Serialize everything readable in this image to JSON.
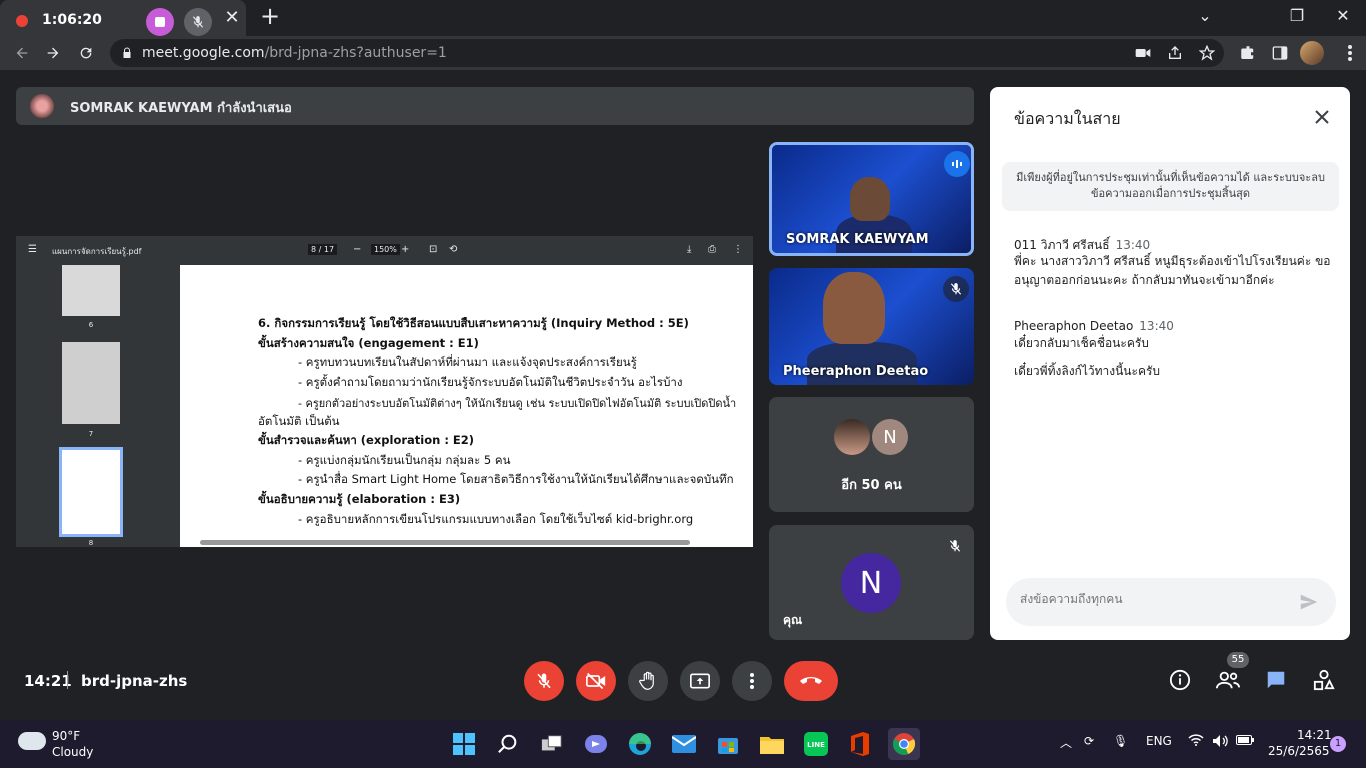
{
  "recording": {
    "time": "1:06:20"
  },
  "browser": {
    "url_domain": "meet.google.com",
    "url_path": "/brd-jpna-zhs?authuser=1"
  },
  "presenter": {
    "text": "SOMRAK KAEWYAM กำลังนำเสนอ"
  },
  "pdf": {
    "filename": "แผนการจัดการเรียนรู้.pdf",
    "page_indicator": "8  /  17",
    "zoom": "150%",
    "thumbnails": [
      {
        "label": "6"
      },
      {
        "label": "7"
      },
      {
        "label": "8"
      }
    ],
    "lines": [
      {
        "text": "6. กิจกรรมการเรียนรู้ โดยใช้วิธีสอนแบบสืบเสาะหาความรู้ (Inquiry Method : 5E)"
      },
      {
        "text": "ขั้นสร้างความสนใจ (engagement : E1)"
      },
      {
        "text": "- ครูทบทวนบทเรียนในสัปดาห์ที่ผ่านมา และแจ้งจุดประสงค์การเรียนรู้"
      },
      {
        "text": "- ครูตั้งคำถามโดยถามว่านักเรียนรู้จักระบบอัตโนมัติในชีวิตประจำวัน อะไรบ้าง"
      },
      {
        "text": "- ครูยกตัวอย่างระบบอัตโนมัติต่างๆ ให้นักเรียนดู เช่น ระบบเปิดปิดไฟอัตโนมัติ ระบบเปิดปิดน้ำ"
      },
      {
        "text": "อัตโนมัติ เป็นต้น"
      },
      {
        "text": "ขั้นสำรวจและค้นหา (exploration : E2)"
      },
      {
        "text": "- ครูแบ่งกลุ่มนักเรียนเป็นกลุ่ม กลุ่มละ 5 คน"
      },
      {
        "text": "- ครูนำสื่อ Smart Light Home โดยสาธิตวิธีการใช้งานให้นักเรียนได้ศึกษาและจดบันทึก"
      },
      {
        "text": "ขั้นอธิบายความรู้ (elaboration : E3)"
      },
      {
        "text": "- ครูอธิบายหลักการเขียนโปรแกรมแบบทางเลือก โดยใช้เว็บไซต์ kid-brighr.org"
      }
    ]
  },
  "tiles": {
    "presenter_name": "SOMRAK KAEWYAM",
    "second_name": "Pheeraphon Deetao",
    "others_label": "อีก 50 คน",
    "others_avatar_letter": "N",
    "self_label": "คุณ",
    "self_avatar_letter": "N"
  },
  "chat": {
    "title": "ข้อความในสาย",
    "notice": "มีเพียงผู้ที่อยู่ในการประชุมเท่านั้นที่เห็นข้อความได้ และระบบจะลบข้อความออกเมื่อการประชุมสิ้นสุด",
    "messages": [
      {
        "sender": "011 วิภาวี ศรีสนธิ์",
        "time": "13:40",
        "text": "พี่คะ นางสาววิภาวี ศรีสนธิ์ หนูมีธุระต้องเข้าไปโรงเรียนค่ะ ขออนุญาตออกก่อนนะคะ ถ้ากลับมาทันจะเข้ามาอีกค่ะ"
      },
      {
        "sender": "Pheeraphon Deetao",
        "time": "13:40",
        "text": "เดี๋ยวกลับมาเช็คชื่อนะครับ",
        "text2": "เดี๋ยวพี่ทิ้งลิงก์ไว้ทางนี้นะครับ"
      }
    ],
    "input_placeholder": "ส่งข้อความถึงทุกคน"
  },
  "meeting": {
    "time": "14:21",
    "code": "brd-jpna-zhs",
    "participants_count": "55"
  },
  "taskbar": {
    "weather_temp": "90°F",
    "weather_desc": "Cloudy",
    "lang": "ENG",
    "clock_time": "14:21",
    "clock_date": "25/6/2565",
    "notifications": "1"
  }
}
